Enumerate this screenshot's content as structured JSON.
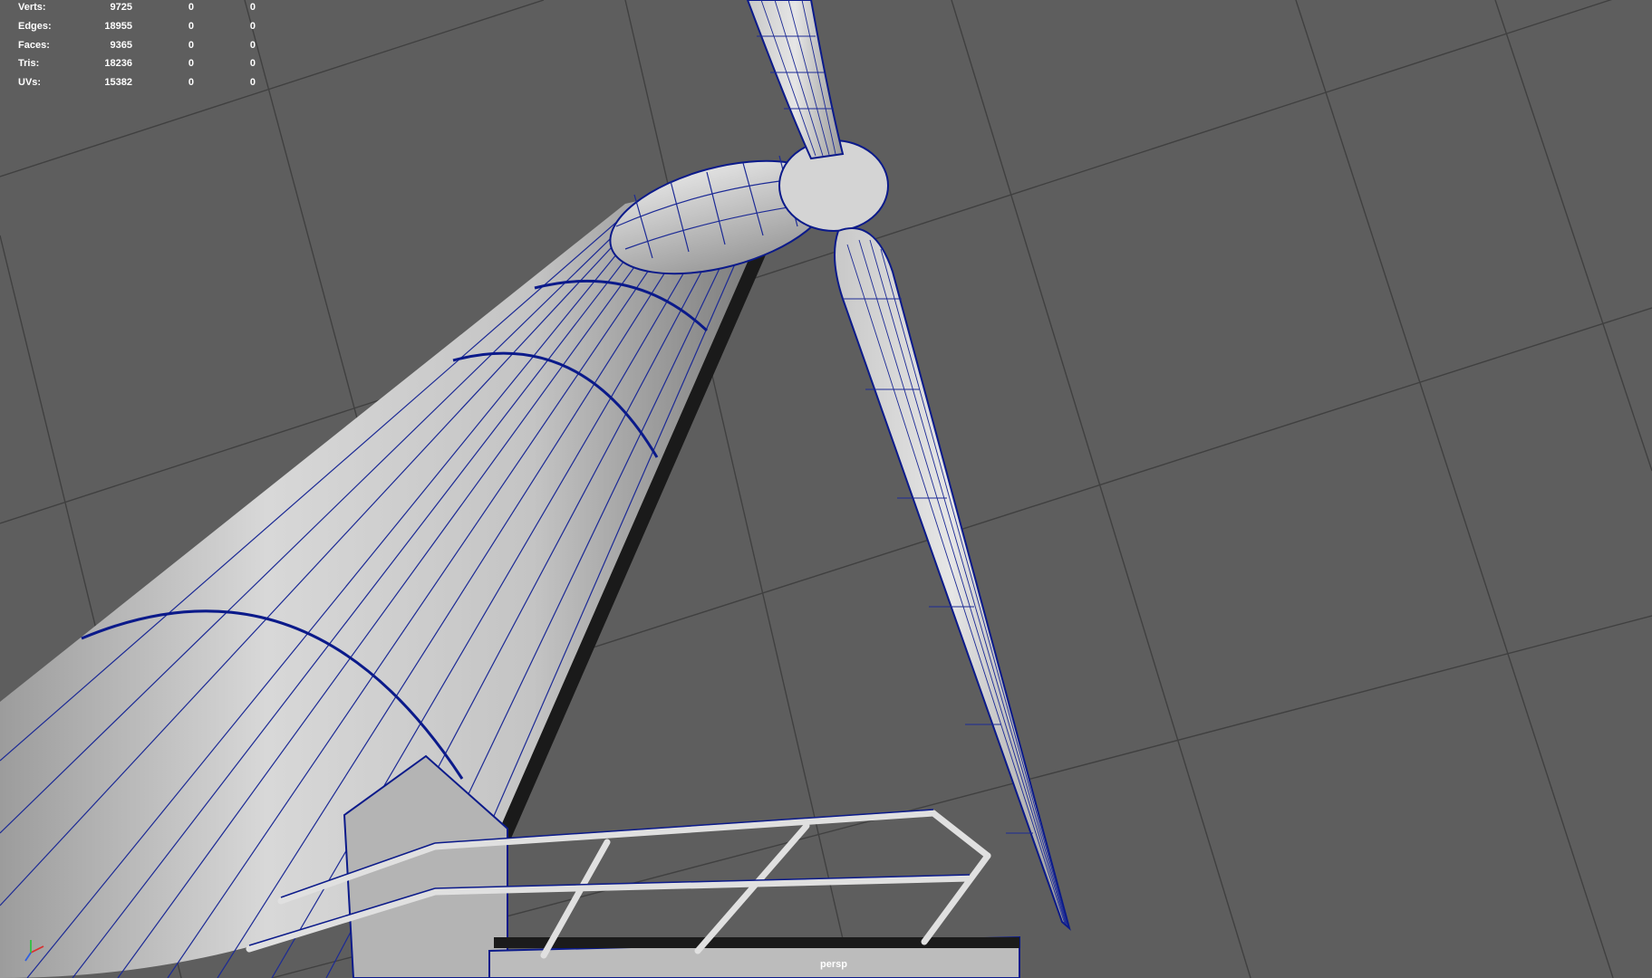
{
  "hud": {
    "rows": [
      {
        "label": "Verts:",
        "values": [
          "9725",
          "0",
          "0"
        ]
      },
      {
        "label": "Edges:",
        "values": [
          "18955",
          "0",
          "0"
        ]
      },
      {
        "label": "Faces:",
        "values": [
          "9365",
          "0",
          "0"
        ]
      },
      {
        "label": "Tris:",
        "values": [
          "18236",
          "0",
          "0"
        ]
      },
      {
        "label": "UVs:",
        "values": [
          "15382",
          "0",
          "0"
        ]
      }
    ]
  },
  "viewport": {
    "camera_label": "persp",
    "background_color": "#5e5e5e",
    "grid_color": "#3f3f3f",
    "wire_color": "#0b1a8a",
    "mesh_color": "#cfcfcf"
  },
  "axis_indicator": {
    "x_color": "#d93030",
    "y_color": "#30c040",
    "z_color": "#3060e0"
  }
}
